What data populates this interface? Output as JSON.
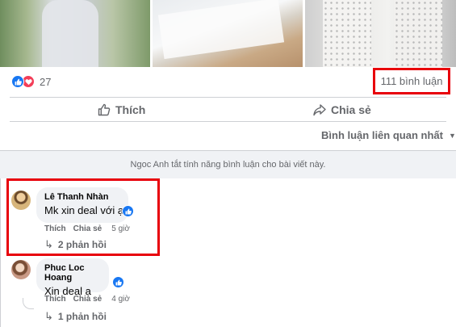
{
  "post": {
    "photos": [
      "photo",
      "photo",
      "photo"
    ],
    "reaction_count": "27",
    "comment_count": "111 bình luận",
    "actions": {
      "like": "Thích",
      "share": "Chia sẻ"
    },
    "sort_label": "Bình luận liên quan nhất",
    "notice": "Ngoc Anh tắt tính năng bình luận cho bài viết này."
  },
  "comments": [
    {
      "author": "Lê Thanh Nhàn",
      "text": "Mk xin deal với ạ",
      "like": "Thích",
      "share": "Chia sẻ",
      "time": "5 giờ",
      "replies": "2 phản hồi"
    },
    {
      "author": "Phuc Loc Hoang",
      "text": "Xin deal ạ",
      "like": "Thích",
      "share": "Chia sẻ",
      "time": "4 giờ",
      "replies": "1 phản hồi"
    }
  ],
  "colors": {
    "accent": "#1877f2",
    "love": "#f33e58",
    "highlight": "#e8000b",
    "muted": "#65676b",
    "bubble": "#f0f2f5"
  },
  "icons": [
    "like-reaction-icon",
    "love-reaction-icon",
    "thumbs-up-icon",
    "share-icon",
    "caret-down-icon",
    "reply-arrow-icon"
  ]
}
